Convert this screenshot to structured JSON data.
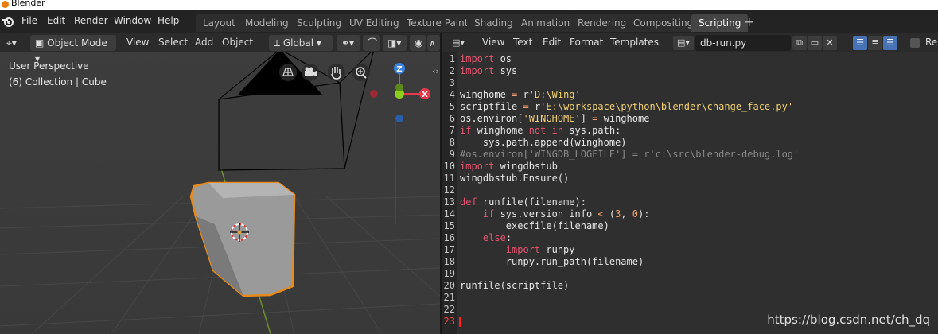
{
  "window": {
    "title": "Blender"
  },
  "menubar": {
    "items": [
      "File",
      "Edit",
      "Render",
      "Window",
      "Help"
    ]
  },
  "workspaces": {
    "tabs": [
      "Layout",
      "Modeling",
      "Sculpting",
      "UV Editing",
      "Texture Paint",
      "Shading",
      "Animation",
      "Rendering",
      "Compositing",
      "Scripting"
    ],
    "active": "Scripting"
  },
  "viewport": {
    "mode": "Object Mode",
    "menus": [
      "View",
      "Select",
      "Add",
      "Object"
    ],
    "transform_orientation": "Global",
    "info_line1": "User Perspective",
    "info_line2": "(6) Collection | Cube",
    "gizmo": {
      "z_label": "Z",
      "x_label": "X"
    }
  },
  "editor": {
    "menus": [
      "View",
      "Text",
      "Edit",
      "Format",
      "Templates"
    ],
    "filename": "db-run.py",
    "toggle_label": "Re",
    "current_line": 23,
    "lines": [
      "import os",
      "import sys",
      "",
      "winghome = r'D:\\Wing'",
      "scriptfile = r'E:\\workspace\\python\\blender\\change_face.py'",
      "os.environ['WINGHOME'] = winghome",
      "if winghome not in sys.path:",
      "    sys.path.append(winghome)",
      "#os.environ['WINGDB_LOGFILE'] = r'c:\\src\\blender-debug.log'",
      "import wingdbstub",
      "wingdbstub.Ensure()",
      "",
      "def runfile(filename):",
      "    if sys.version_info < (3, 0):",
      "        execfile(filename)",
      "    else:",
      "        import runpy",
      "        runpy.run_path(filename)",
      "",
      "runfile(scriptfile)",
      "",
      "",
      ""
    ]
  },
  "watermark": "https://blog.csdn.net/ch_dq",
  "colors": {
    "accent": "#4772b3",
    "selection_outline": "#e88a1a",
    "axis_x": "#e8384c",
    "axis_y": "#8ccf1a",
    "axis_z": "#3a82e6",
    "keyword": "#e45470",
    "string": "#f0d070"
  }
}
